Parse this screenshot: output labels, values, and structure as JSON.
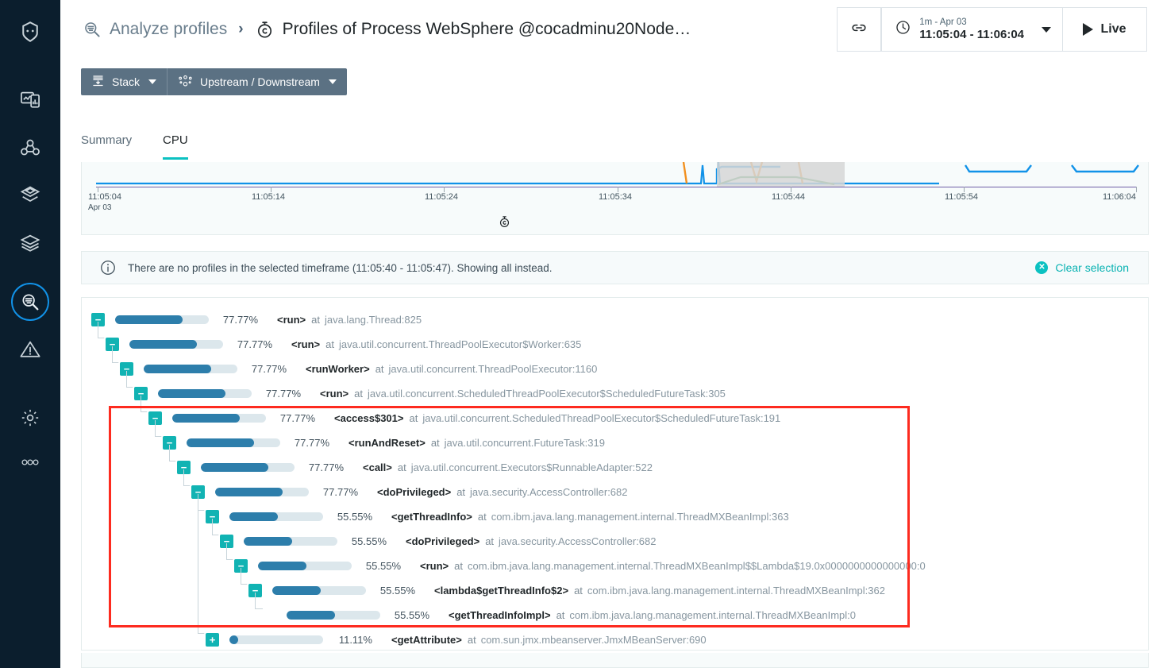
{
  "sidebar": {
    "items": [
      {
        "name": "robot-logo-icon",
        "label": "Instana"
      },
      {
        "name": "dashboard-icon",
        "label": "Dashboards"
      },
      {
        "name": "applications-icon",
        "label": "Applications"
      },
      {
        "name": "services-icon",
        "label": "Services"
      },
      {
        "name": "infrastructure-icon",
        "label": "Infrastructure"
      },
      {
        "name": "analyze-icon",
        "label": "Analytics",
        "active": true
      },
      {
        "name": "events-warning-icon",
        "label": "Events"
      },
      {
        "name": "settings-gear-icon",
        "label": "Settings"
      },
      {
        "name": "more-options-icon",
        "label": "More"
      }
    ]
  },
  "header": {
    "breadcrumb_icon": "analyze-profiles-icon",
    "breadcrumb_root": "Analyze profiles",
    "breadcrumb_separator": "›",
    "page_icon": "stopwatch-icon",
    "page_title": "Profiles of Process WebSphere @cocadminu20Node…",
    "link_button_icon": "link-chain-icon",
    "time_picker": {
      "icon": "clock-icon",
      "range_label": "1m - Apr 03",
      "range_value": "11:05:04 - 11:06:04",
      "caret": "chevron-down-icon"
    },
    "live_button": {
      "icon": "play-icon",
      "label": "Live"
    }
  },
  "toolbar": {
    "stack": {
      "icon": "stack-icon",
      "label": "Stack",
      "caret": "chevron-down-icon"
    },
    "upstream_downstream": {
      "icon": "nodes-icon",
      "label": "Upstream / Downstream",
      "caret": "chevron-down-icon"
    }
  },
  "tabs": [
    {
      "label": "Summary",
      "active": false
    },
    {
      "label": "CPU",
      "active": true
    }
  ],
  "chart_data": {
    "type": "line",
    "title": "",
    "xlabel": "",
    "ylabel": "",
    "grid": false,
    "legend": "none",
    "x_ticks": [
      "11:05:04",
      "11:05:14",
      "11:05:24",
      "11:05:34",
      "11:05:44",
      "11:05:54",
      "11:06:04"
    ],
    "x_tick_sub": "Apr 03",
    "selection_band": {
      "from": "11:05:40",
      "to": "11:05:47"
    },
    "series": [
      {
        "name": "blue",
        "color": "#1192e8"
      },
      {
        "name": "orange",
        "color": "#f2901f"
      },
      {
        "name": "green",
        "color": "#3f9b56"
      },
      {
        "name": "purple",
        "color": "#6f5fa6"
      }
    ],
    "marker_icon": "stopwatch-icon"
  },
  "info_bar": {
    "icon": "info-circle-icon",
    "message": "There are no profiles in the selected timeframe (11:05:40 - 11:05:47). Showing all instead.",
    "clear_button": {
      "icon": "close-circle-icon",
      "label": "Clear selection"
    }
  },
  "call_tree": {
    "at_label": "at",
    "rows": [
      {
        "depth": 0,
        "toggle": "−",
        "pct": "77.77%",
        "fill": 72,
        "fn": "<run>",
        "loc": "java.lang.Thread:825"
      },
      {
        "depth": 1,
        "toggle": "−",
        "pct": "77.77%",
        "fill": 72,
        "fn": "<run>",
        "loc": "java.util.concurrent.ThreadPoolExecutor$Worker:635"
      },
      {
        "depth": 2,
        "toggle": "−",
        "pct": "77.77%",
        "fill": 72,
        "fn": "<runWorker>",
        "loc": "java.util.concurrent.ThreadPoolExecutor:1160"
      },
      {
        "depth": 3,
        "toggle": "−",
        "pct": "77.77%",
        "fill": 72,
        "fn": "<run>",
        "loc": "java.util.concurrent.ScheduledThreadPoolExecutor$ScheduledFutureTask:305"
      },
      {
        "depth": 4,
        "toggle": "−",
        "pct": "77.77%",
        "fill": 72,
        "fn": "<access$301>",
        "loc": "java.util.concurrent.ScheduledThreadPoolExecutor$ScheduledFutureTask:191"
      },
      {
        "depth": 5,
        "toggle": "−",
        "pct": "77.77%",
        "fill": 72,
        "fn": "<runAndReset>",
        "loc": "java.util.concurrent.FutureTask:319"
      },
      {
        "depth": 6,
        "toggle": "−",
        "pct": "77.77%",
        "fill": 72,
        "fn": "<call>",
        "loc": "java.util.concurrent.Executors$RunnableAdapter:522"
      },
      {
        "depth": 7,
        "toggle": "−",
        "pct": "77.77%",
        "fill": 72,
        "fn": "<doPrivileged>",
        "loc": "java.security.AccessController:682"
      },
      {
        "depth": 8,
        "toggle": "−",
        "pct": "55.55%",
        "fill": 52,
        "fn": "<getThreadInfo>",
        "loc": "com.ibm.java.lang.management.internal.ThreadMXBeanImpl:363"
      },
      {
        "depth": 9,
        "toggle": "−",
        "pct": "55.55%",
        "fill": 52,
        "fn": "<doPrivileged>",
        "loc": "java.security.AccessController:682"
      },
      {
        "depth": 10,
        "toggle": "−",
        "pct": "55.55%",
        "fill": 52,
        "fn": "<run>",
        "loc": "com.ibm.java.lang.management.internal.ThreadMXBeanImpl$$Lambda$19.0x0000000000000000:0"
      },
      {
        "depth": 11,
        "toggle": "−",
        "pct": "55.55%",
        "fill": 52,
        "fn": "<lambda$getThreadInfo$2>",
        "loc": "com.ibm.java.lang.management.internal.ThreadMXBeanImpl:362"
      },
      {
        "depth": 12,
        "toggle": "",
        "pct": "55.55%",
        "fill": 52,
        "fn": "<getThreadInfoImpl>",
        "loc": "com.ibm.java.lang.management.internal.ThreadMXBeanImpl:0"
      },
      {
        "depth": 8,
        "toggle": "+",
        "pct": "11.11%",
        "fill": 9,
        "fn": "<getAttribute>",
        "loc": "com.sun.jmx.mbeanserver.JmxMBeanServer:690"
      }
    ]
  },
  "annotation": {
    "highlight_box_color": "#fd2b1f"
  }
}
